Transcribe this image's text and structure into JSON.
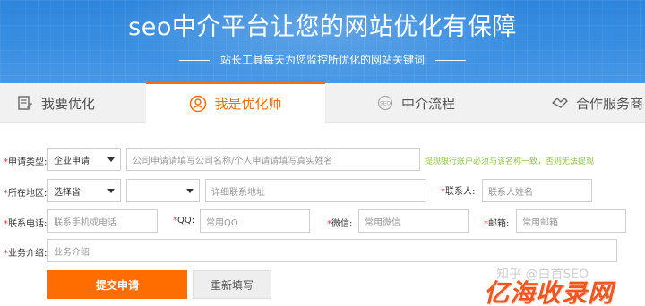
{
  "banner": {
    "title": "seo中介平台让您的网站优化有保障",
    "subtitle": "站长工具每天为您监控所优化的网站关键词"
  },
  "tabs": [
    {
      "label": "我要优化",
      "icon": "doc-edit-icon",
      "active": false
    },
    {
      "label": "我是优化师",
      "icon": "user-badge-icon",
      "active": true
    },
    {
      "label": "中介流程",
      "icon": "process-circle-icon",
      "active": false
    },
    {
      "label": "合作服务商",
      "icon": "handshake-icon",
      "active": false
    }
  ],
  "form": {
    "apply_type": {
      "label": "申请类型:",
      "value": "企业申请"
    },
    "company_name": {
      "placeholder": "公司申请请填写公司名称/个人申请请填写真实姓名"
    },
    "name_hint": "提现银行账户必须与该名称一致，否则无法提现",
    "region": {
      "label": "所在地区:",
      "province": "选择省",
      "city": ""
    },
    "address": {
      "placeholder": "详细联系地址"
    },
    "contact": {
      "label": "联系人:",
      "placeholder": "联系人姓名"
    },
    "phone": {
      "label": "联系电话:",
      "placeholder": "联系手机或电话"
    },
    "qq": {
      "label": "QQ:",
      "placeholder": "常用QQ"
    },
    "wechat": {
      "label": "微信:",
      "placeholder": "常用微信"
    },
    "email": {
      "label": "邮箱:",
      "placeholder": "常用邮箱"
    },
    "intro": {
      "label": "业务介绍:",
      "placeholder": "业务介绍"
    },
    "submit_label": "提交申请",
    "reset_label": "重新填写",
    "required_mark": "*"
  },
  "watermark": {
    "zhihu": "知乎 @白首SEO",
    "logo": "亿海收录网"
  },
  "colors": {
    "banner": "#3a8fe2",
    "accent": "#ff6c00",
    "hint": "#8cc63f"
  }
}
